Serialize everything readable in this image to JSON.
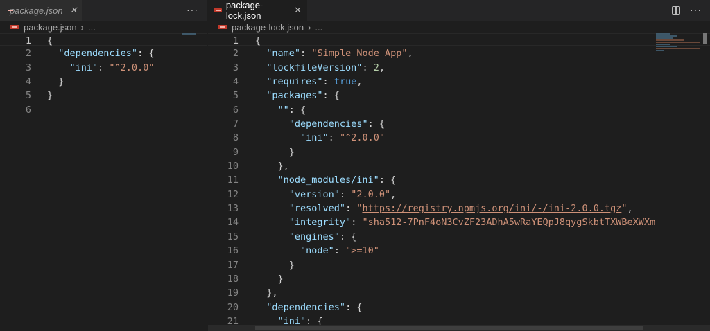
{
  "left": {
    "tab": {
      "label": "package.json",
      "icon": "json-icon"
    },
    "breadcrumb": {
      "file": "package.json",
      "more": "..."
    },
    "more_actions": "···",
    "lines": [
      [
        [
          "p",
          "{"
        ]
      ],
      [
        [
          "p",
          "  "
        ],
        [
          "k",
          "\"dependencies\""
        ],
        [
          "p",
          ": {"
        ]
      ],
      [
        [
          "p",
          "    "
        ],
        [
          "k",
          "\"ini\""
        ],
        [
          "p",
          ": "
        ],
        [
          "s",
          "\"^2.0.0\""
        ]
      ],
      [
        [
          "p",
          "  }"
        ]
      ],
      [
        [
          "p",
          "}"
        ]
      ],
      []
    ]
  },
  "right": {
    "tab": {
      "label": "package-lock.json",
      "icon": "json-icon"
    },
    "breadcrumb": {
      "file": "package-lock.json",
      "more": "..."
    },
    "more_actions": "···",
    "lines": [
      [
        [
          "p",
          "{"
        ]
      ],
      [
        [
          "p",
          "  "
        ],
        [
          "k",
          "\"name\""
        ],
        [
          "p",
          ": "
        ],
        [
          "s",
          "\"Simple Node App\""
        ],
        [
          "p",
          ","
        ]
      ],
      [
        [
          "p",
          "  "
        ],
        [
          "k",
          "\"lockfileVersion\""
        ],
        [
          "p",
          ": "
        ],
        [
          "n",
          "2"
        ],
        [
          "p",
          ","
        ]
      ],
      [
        [
          "p",
          "  "
        ],
        [
          "k",
          "\"requires\""
        ],
        [
          "p",
          ": "
        ],
        [
          "b",
          "true"
        ],
        [
          "p",
          ","
        ]
      ],
      [
        [
          "p",
          "  "
        ],
        [
          "k",
          "\"packages\""
        ],
        [
          "p",
          ": {"
        ]
      ],
      [
        [
          "p",
          "    "
        ],
        [
          "k",
          "\"\""
        ],
        [
          "p",
          ": {"
        ]
      ],
      [
        [
          "p",
          "      "
        ],
        [
          "k",
          "\"dependencies\""
        ],
        [
          "p",
          ": {"
        ]
      ],
      [
        [
          "p",
          "        "
        ],
        [
          "k",
          "\"ini\""
        ],
        [
          "p",
          ": "
        ],
        [
          "s",
          "\"^2.0.0\""
        ]
      ],
      [
        [
          "p",
          "      }"
        ]
      ],
      [
        [
          "p",
          "    },"
        ]
      ],
      [
        [
          "p",
          "    "
        ],
        [
          "k",
          "\"node_modules/ini\""
        ],
        [
          "p",
          ": {"
        ]
      ],
      [
        [
          "p",
          "      "
        ],
        [
          "k",
          "\"version\""
        ],
        [
          "p",
          ": "
        ],
        [
          "s",
          "\"2.0.0\""
        ],
        [
          "p",
          ","
        ]
      ],
      [
        [
          "p",
          "      "
        ],
        [
          "k",
          "\"resolved\""
        ],
        [
          "p",
          ": "
        ],
        [
          "s",
          "\""
        ],
        [
          "u",
          "https://registry.npmjs.org/ini/-/ini-2.0.0.tgz"
        ],
        [
          "s",
          "\""
        ],
        [
          "p",
          ","
        ]
      ],
      [
        [
          "p",
          "      "
        ],
        [
          "k",
          "\"integrity\""
        ],
        [
          "p",
          ": "
        ],
        [
          "s",
          "\"sha512-7PnF4oN3CvZF23ADhA5wRaYEQpJ8qygSkbtTXWBeXWXm"
        ]
      ],
      [
        [
          "p",
          "      "
        ],
        [
          "k",
          "\"engines\""
        ],
        [
          "p",
          ": {"
        ]
      ],
      [
        [
          "p",
          "        "
        ],
        [
          "k",
          "\"node\""
        ],
        [
          "p",
          ": "
        ],
        [
          "s",
          "\">=10\""
        ]
      ],
      [
        [
          "p",
          "      }"
        ]
      ],
      [
        [
          "p",
          "    }"
        ]
      ],
      [
        [
          "p",
          "  },"
        ]
      ],
      [
        [
          "p",
          "  "
        ],
        [
          "k",
          "\"dependencies\""
        ],
        [
          "p",
          ": {"
        ]
      ],
      [
        [
          "p",
          "    "
        ],
        [
          "k",
          "\"ini\""
        ],
        [
          "p",
          ": {"
        ]
      ]
    ]
  }
}
